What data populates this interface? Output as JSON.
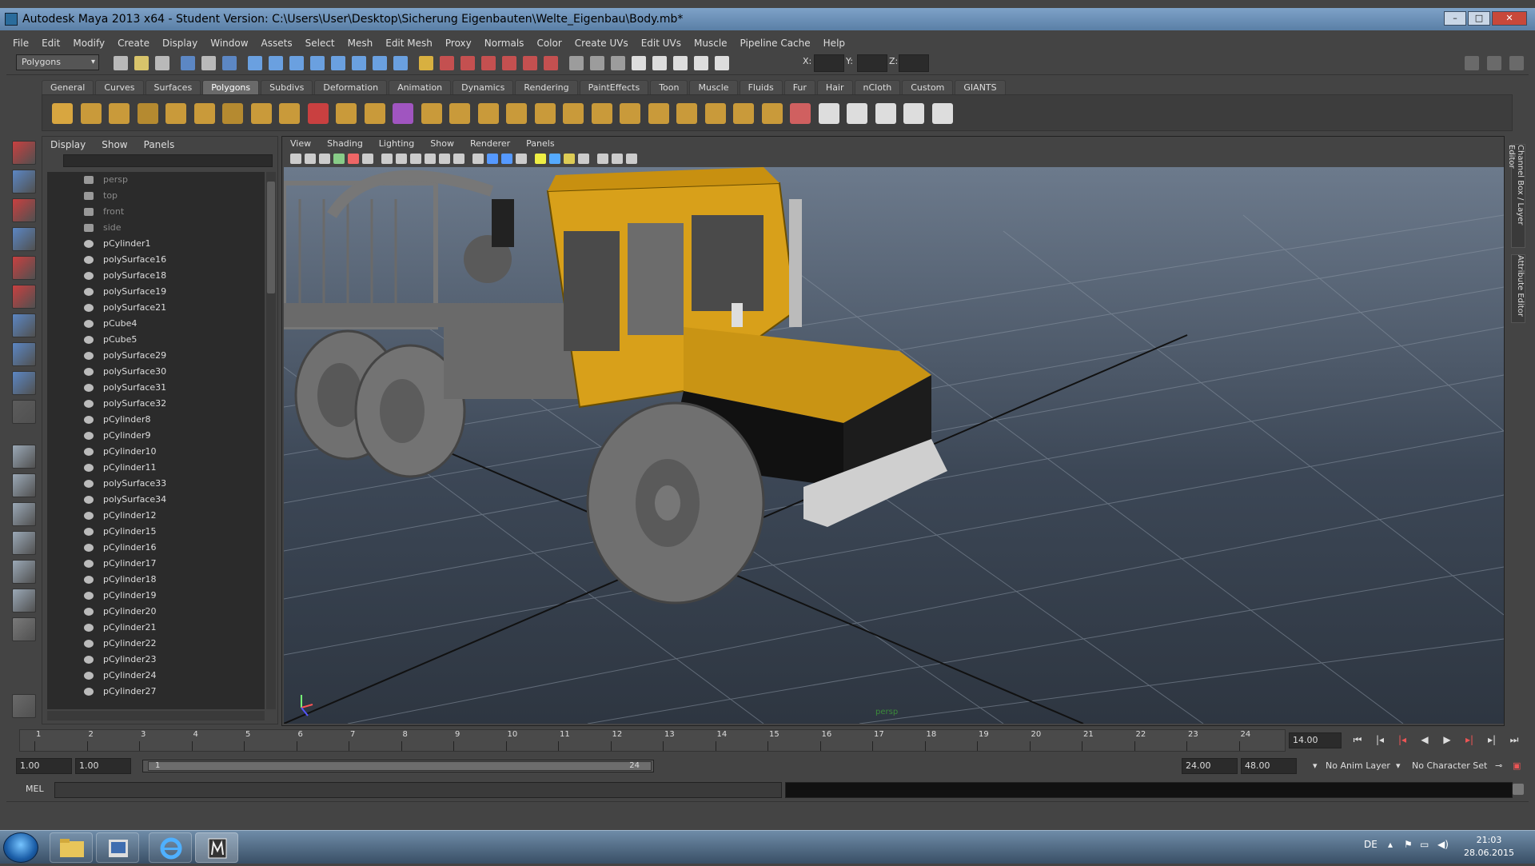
{
  "window": {
    "title": "Autodesk Maya 2013 x64 - Student Version: C:\\Users\\User\\Desktop\\Sicherung Eigenbauten\\Welte_Eigenbau\\Body.mb*",
    "minimize": "–",
    "maximize": "□",
    "close": "✕"
  },
  "menubar": [
    "File",
    "Edit",
    "Modify",
    "Create",
    "Display",
    "Window",
    "Assets",
    "Select",
    "Mesh",
    "Edit Mesh",
    "Proxy",
    "Normals",
    "Color",
    "Create UVs",
    "Edit UVs",
    "Muscle",
    "Pipeline Cache",
    "Help"
  ],
  "status_line": {
    "mode": "Polygons",
    "x_label": "X:",
    "y_label": "Y:",
    "z_label": "Z:"
  },
  "shelf": {
    "tabs": [
      "General",
      "Curves",
      "Surfaces",
      "Polygons",
      "Subdivs",
      "Deformation",
      "Animation",
      "Dynamics",
      "Rendering",
      "PaintEffects",
      "Toon",
      "Muscle",
      "Fluids",
      "Fur",
      "Hair",
      "nCloth",
      "Custom",
      "GIANTS"
    ],
    "active_tab": "Polygons"
  },
  "outliner": {
    "menu": [
      "Display",
      "Show",
      "Panels"
    ],
    "items": [
      {
        "label": "persp",
        "type": "camera"
      },
      {
        "label": "top",
        "type": "camera"
      },
      {
        "label": "front",
        "type": "camera"
      },
      {
        "label": "side",
        "type": "camera"
      },
      {
        "label": "pCylinder1",
        "type": "mesh"
      },
      {
        "label": "polySurface16",
        "type": "mesh"
      },
      {
        "label": "polySurface18",
        "type": "mesh"
      },
      {
        "label": "polySurface19",
        "type": "mesh"
      },
      {
        "label": "polySurface21",
        "type": "mesh"
      },
      {
        "label": "pCube4",
        "type": "mesh"
      },
      {
        "label": "pCube5",
        "type": "mesh"
      },
      {
        "label": "polySurface29",
        "type": "mesh"
      },
      {
        "label": "polySurface30",
        "type": "mesh"
      },
      {
        "label": "polySurface31",
        "type": "mesh"
      },
      {
        "label": "polySurface32",
        "type": "mesh"
      },
      {
        "label": "pCylinder8",
        "type": "mesh"
      },
      {
        "label": "pCylinder9",
        "type": "mesh"
      },
      {
        "label": "pCylinder10",
        "type": "mesh"
      },
      {
        "label": "pCylinder11",
        "type": "mesh"
      },
      {
        "label": "polySurface33",
        "type": "mesh"
      },
      {
        "label": "polySurface34",
        "type": "mesh"
      },
      {
        "label": "pCylinder12",
        "type": "mesh"
      },
      {
        "label": "pCylinder15",
        "type": "mesh"
      },
      {
        "label": "pCylinder16",
        "type": "mesh"
      },
      {
        "label": "pCylinder17",
        "type": "mesh"
      },
      {
        "label": "pCylinder18",
        "type": "mesh"
      },
      {
        "label": "pCylinder19",
        "type": "mesh"
      },
      {
        "label": "pCylinder20",
        "type": "mesh"
      },
      {
        "label": "pCylinder21",
        "type": "mesh"
      },
      {
        "label": "pCylinder22",
        "type": "mesh"
      },
      {
        "label": "pCylinder23",
        "type": "mesh"
      },
      {
        "label": "pCylinder24",
        "type": "mesh"
      },
      {
        "label": "pCylinder27",
        "type": "mesh"
      }
    ]
  },
  "viewport": {
    "menu": [
      "View",
      "Shading",
      "Lighting",
      "Show",
      "Renderer",
      "Panels"
    ],
    "camera_label": "persp"
  },
  "right_tabs": {
    "channel_box": "Channel Box / Layer Editor",
    "attribute_editor": "Attribute Editor"
  },
  "timeline": {
    "ticks": [
      "1",
      "2",
      "3",
      "4",
      "5",
      "6",
      "7",
      "8",
      "9",
      "10",
      "11",
      "12",
      "13",
      "14",
      "15",
      "16",
      "17",
      "18",
      "19",
      "20",
      "21",
      "22",
      "23",
      "24"
    ],
    "current_frame": "14.00"
  },
  "range": {
    "start": "1.00",
    "playback_start": "1.00",
    "slider_start": "1",
    "slider_end": "24",
    "playback_end": "24.00",
    "end": "48.00",
    "anim_layer": "No Anim Layer",
    "character_set": "No Character Set"
  },
  "command_line": {
    "label": "MEL"
  },
  "taskbar": {
    "language": "DE",
    "time": "21:03",
    "date": "28.06.2015"
  },
  "colors": {
    "cab_yellow": "#d8a01a",
    "tire_gray": "#6e6e6e",
    "ui_bg": "#444444",
    "field_bg": "#2b2b2b"
  }
}
